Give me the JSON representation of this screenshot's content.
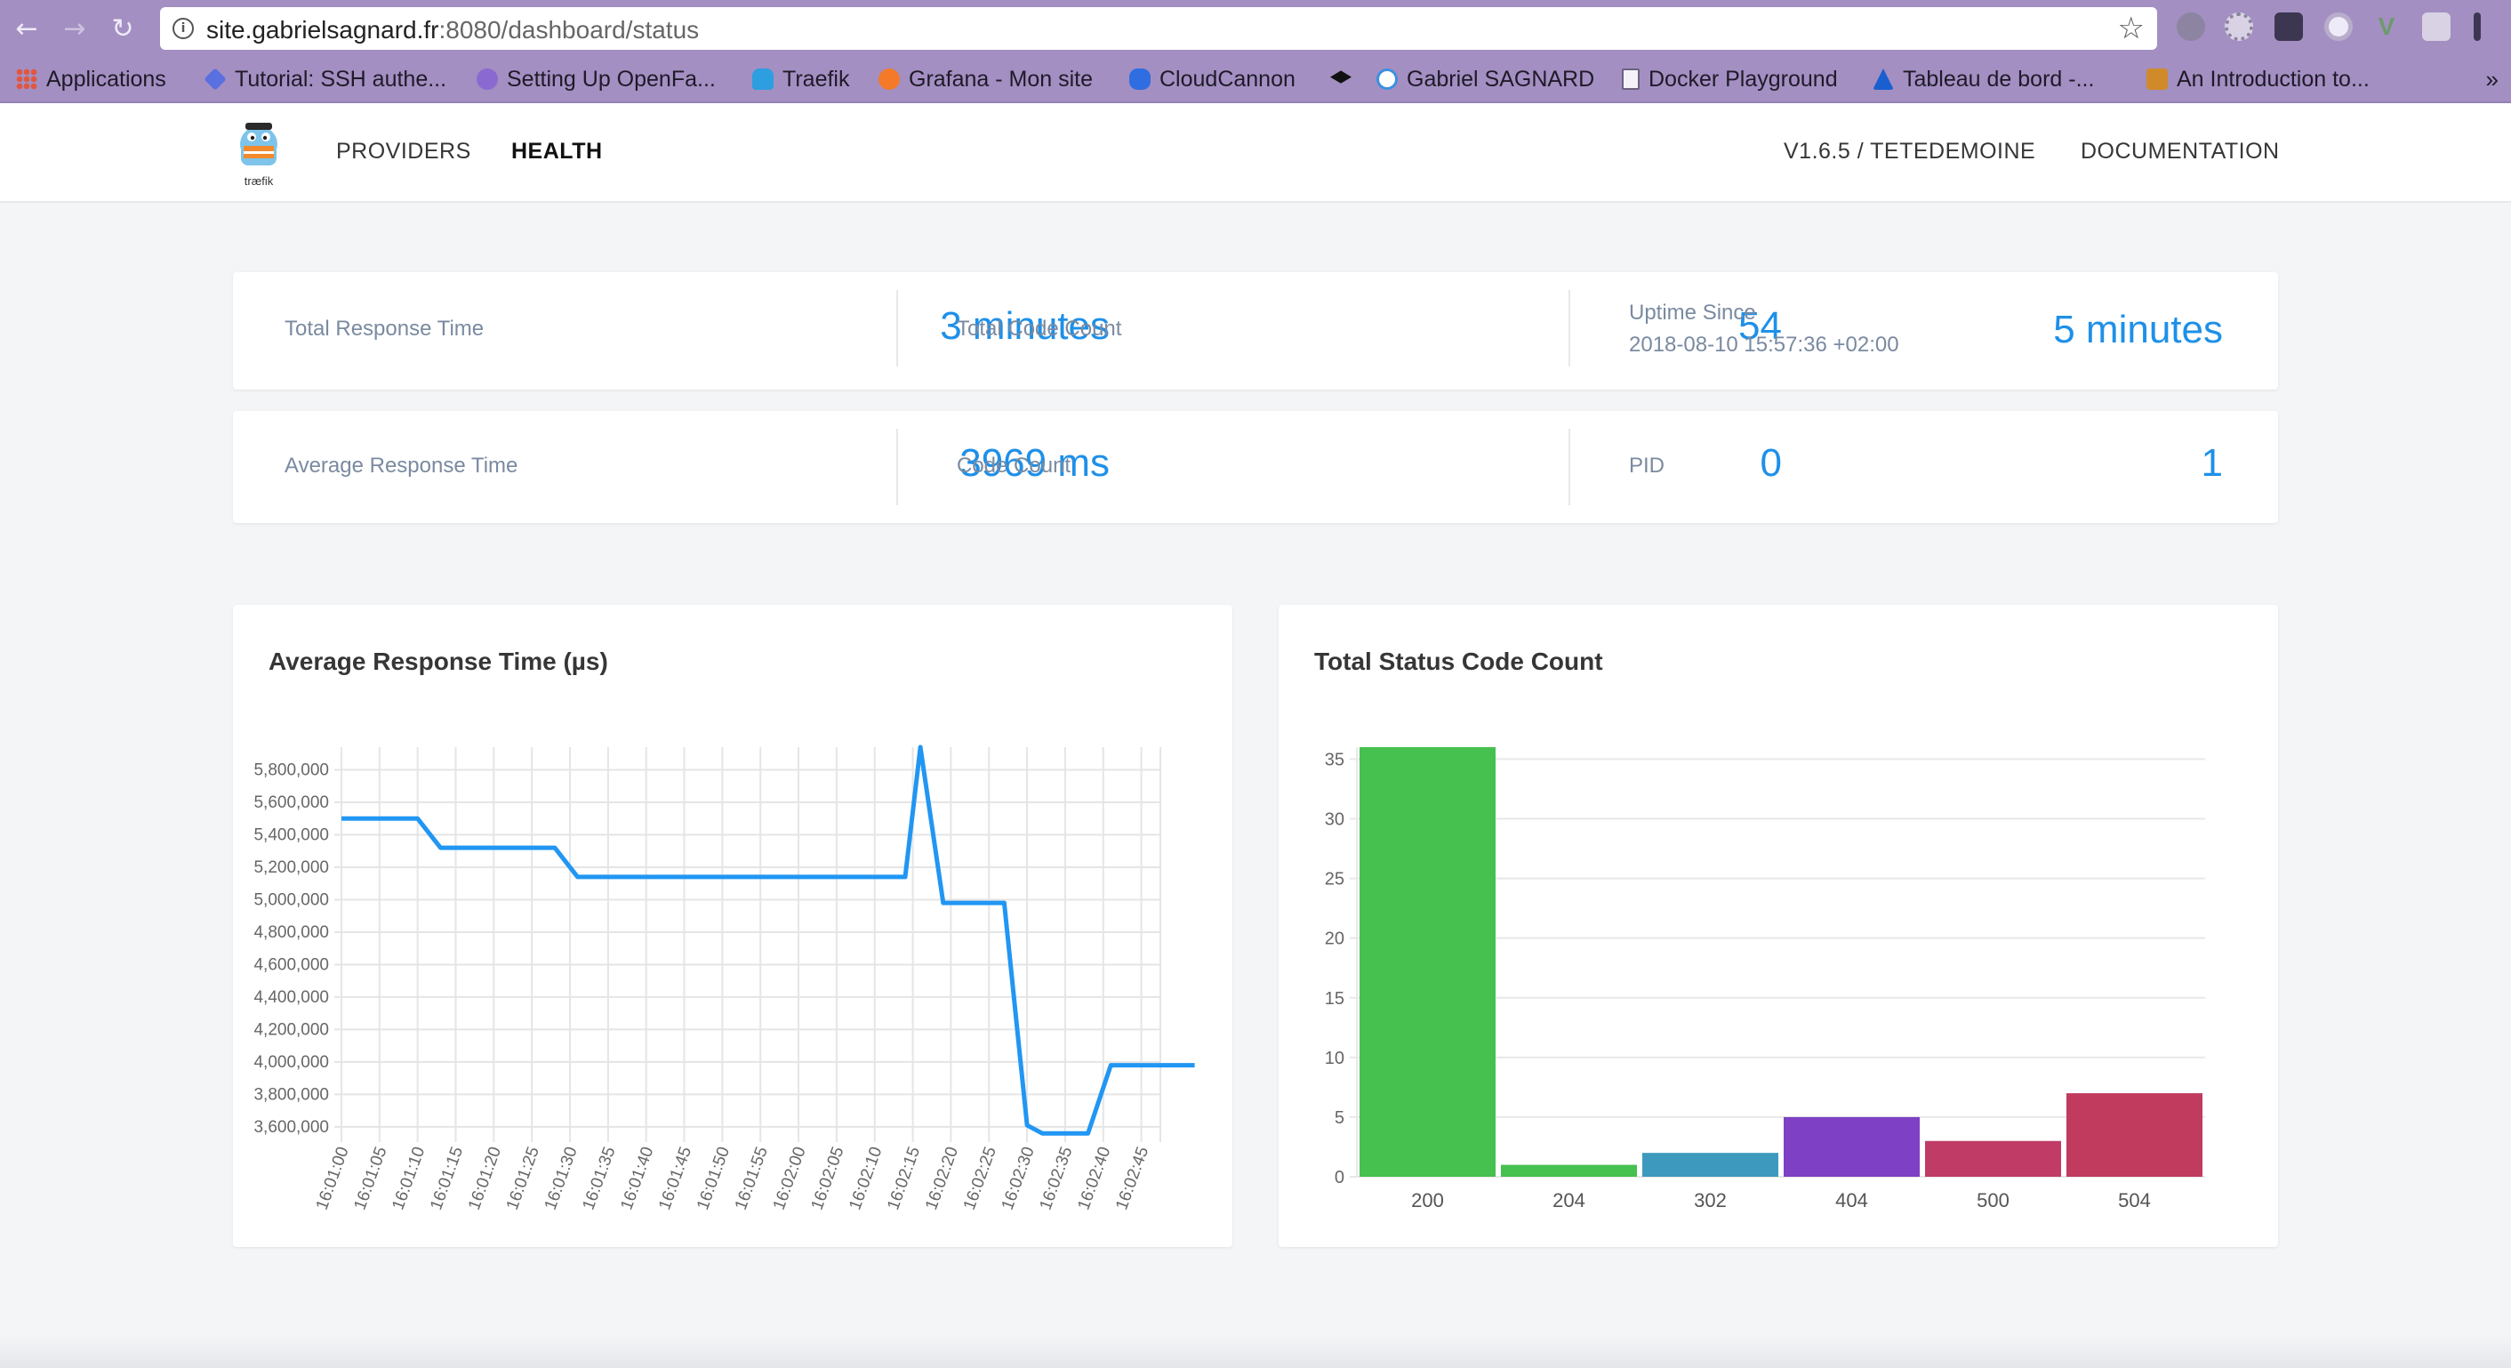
{
  "browser": {
    "url_host": "site.gabrielsagnard.fr",
    "url_rest": ":8080/dashboard/status",
    "bookmarks": [
      {
        "label": "Applications",
        "color": "#e0573f",
        "icon": "apps-grid-icon"
      },
      {
        "label": "Tutorial: SSH authe...",
        "color": "#5a6fe0",
        "icon": "diamond-icon"
      },
      {
        "label": "Setting Up OpenFa...",
        "color": "#8a6ad0",
        "icon": "openfaas-icon"
      },
      {
        "label": "Traefik",
        "color": "#2d9ee0",
        "icon": "traefik-gopher-icon"
      },
      {
        "label": "Grafana - Mon site",
        "color": "#f47a2a",
        "icon": "grafana-icon"
      },
      {
        "label": "CloudCannon",
        "color": "#2f6de0",
        "icon": "cloudcannon-icon"
      },
      {
        "label": "",
        "color": "#111111",
        "icon": "graduation-cap-icon"
      },
      {
        "label": "Gabriel SAGNARD",
        "color": "#3d8fe0",
        "icon": "globe-icon"
      },
      {
        "label": "Docker Playground",
        "color": "#ffffff",
        "icon": "document-icon"
      },
      {
        "label": "Tableau de bord -...",
        "color": "#1a5fd0",
        "icon": "azure-icon"
      },
      {
        "label": "An Introduction to...",
        "color": "#d08a2a",
        "icon": "book-icon"
      }
    ],
    "more_label": "»"
  },
  "nav": {
    "providers": "PROVIDERS",
    "health": "HEALTH",
    "version": "V1.6.5 / TETEDEMOINE",
    "documentation": "DOCUMENTATION",
    "logo_text": "træfik"
  },
  "stats": {
    "total_response_time_label": "Total Response Time",
    "total_response_time_value": "3 minutes",
    "total_code_count_label": "Total Code Count",
    "total_code_count_value": "54",
    "uptime_label": "Uptime Since",
    "uptime_since": "2018-08-10 15:57:36 +02:00",
    "uptime_value": "5 minutes",
    "avg_response_time_label": "Average Response Time",
    "avg_response_time_value": "3969 ms",
    "code_count_label": "Code Count",
    "code_count_value": "0",
    "pid_label": "PID",
    "pid_value": "1"
  },
  "colors": {
    "accent": "#1e90e8",
    "line": "#2196f3"
  },
  "chart_data": [
    {
      "type": "line",
      "title": "Average Response Time (µs)",
      "x": [
        "16:01:00",
        "16:01:05",
        "16:01:10",
        "16:01:15",
        "16:01:20",
        "16:01:25",
        "16:01:30",
        "16:01:35",
        "16:01:40",
        "16:01:45",
        "16:01:50",
        "16:01:55",
        "16:02:00",
        "16:02:05",
        "16:02:10",
        "16:02:15",
        "16:02:20",
        "16:02:25",
        "16:02:30",
        "16:02:35",
        "16:02:40",
        "16:02:45"
      ],
      "y_ticks": [
        3600000,
        3800000,
        4000000,
        4200000,
        4400000,
        4600000,
        4800000,
        5000000,
        5200000,
        5400000,
        5600000,
        5800000
      ],
      "y_tick_labels": [
        "3,600,000",
        "3,800,000",
        "4,000,000",
        "4,200,000",
        "4,400,000",
        "4,600,000",
        "4,800,000",
        "5,000,000",
        "5,200,000",
        "5,400,000",
        "5,600,000",
        "5,800,000"
      ],
      "ylim": [
        3550000,
        5940000
      ],
      "series": [
        {
          "points": [
            [
              "16:01:00",
              5500000
            ],
            [
              "16:01:10",
              5500000
            ],
            [
              "16:01:13",
              5320000
            ],
            [
              "16:01:28",
              5320000
            ],
            [
              "16:01:31",
              5140000
            ],
            [
              "16:02:14",
              5140000
            ],
            [
              "16:02:16",
              5940000
            ],
            [
              "16:02:19",
              4980000
            ],
            [
              "16:02:27",
              4980000
            ],
            [
              "16:02:30",
              3610000
            ],
            [
              "16:02:32",
              3560000
            ],
            [
              "16:02:38",
              3560000
            ],
            [
              "16:02:41",
              3980000
            ],
            [
              "16:02:52",
              3980000
            ]
          ]
        }
      ],
      "grid": true
    },
    {
      "type": "bar",
      "title": "Total Status Code Count",
      "categories": [
        "200",
        "204",
        "302",
        "404",
        "500",
        "504"
      ],
      "values": [
        36,
        1,
        2,
        5,
        3,
        7
      ],
      "colors": [
        "#46c04f",
        "#46c04f",
        "#3d99be",
        "#7e40c4",
        "#c03b66",
        "#c03b5e"
      ],
      "y_ticks": [
        0,
        5,
        10,
        15,
        20,
        25,
        30,
        35
      ],
      "ylim": [
        0,
        36
      ],
      "grid": true
    }
  ]
}
